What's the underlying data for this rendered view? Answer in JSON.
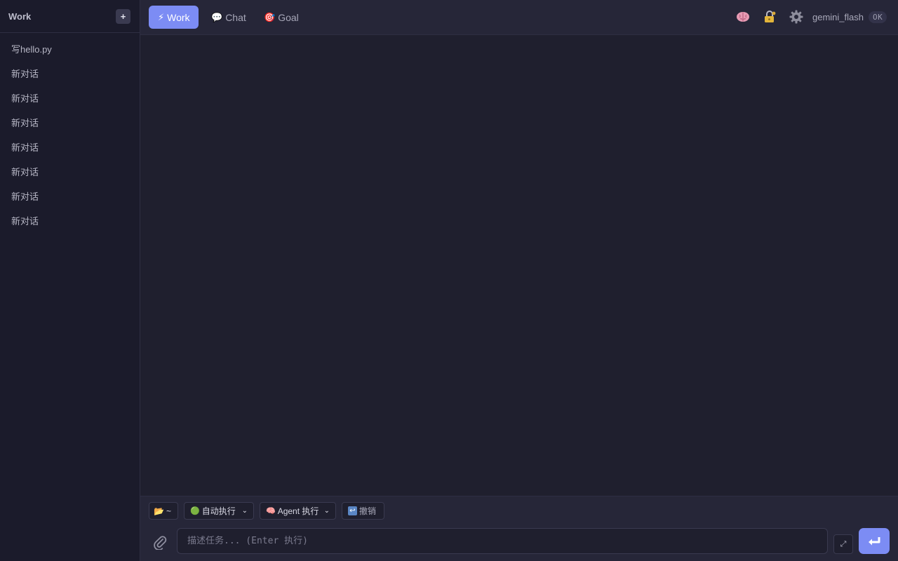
{
  "sidebar": {
    "title": "Work",
    "new_label": "+",
    "items": [
      "写hello.py",
      "新对话",
      "新对话",
      "新对话",
      "新对话",
      "新对话",
      "新对话",
      "新对话"
    ]
  },
  "tabs": [
    {
      "label": "Work",
      "icon": "⚡",
      "active": true
    },
    {
      "label": "Chat",
      "icon": "💬",
      "active": false
    },
    {
      "label": "Goal",
      "icon": "🎯",
      "active": false
    }
  ],
  "header": {
    "icons": [
      "brain-icon",
      "lock-icon",
      "gear-icon"
    ],
    "model": "gemini_flash",
    "status": "OK"
  },
  "toolbar": {
    "folder_icon": "📂",
    "folder_label": "~",
    "exec_mode_icon": "🟢",
    "exec_mode": "自动执行",
    "agent_icon": "🧠",
    "agent_mode": "Agent 执行",
    "undo_icon": "↩",
    "undo_label": "撤销"
  },
  "composer": {
    "placeholder": "描述任务... (Enter 执行)",
    "value": "",
    "expand_label": "⤢"
  },
  "colors": {
    "accent": "#7c8cf4",
    "background": "#1f1f2e",
    "sidebar": "#1b1b2b",
    "panel": "#262638"
  }
}
